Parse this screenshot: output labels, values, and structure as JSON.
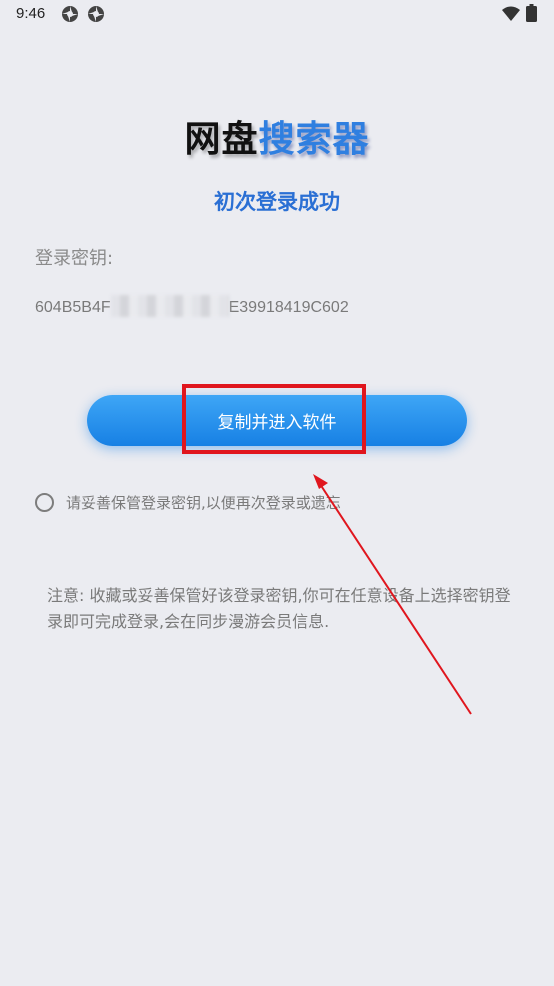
{
  "status_bar": {
    "time": "9:46",
    "icons": [
      "notification-icon",
      "notification-icon",
      "wifi-icon",
      "battery-icon"
    ]
  },
  "title": {
    "part1": "网盘",
    "part2": "搜索器"
  },
  "subtitle": "初次登录成功",
  "key_label": "登录密钥:",
  "key_value": {
    "prefix": "604B5B4F",
    "suffix": "E39918419C602"
  },
  "enter_button": "复制并进入软件",
  "agree_text": "请妥善保管登录密钥,以便再次登录或遗忘",
  "note": "注意: 收藏或妥善保管好该登录密钥,你可在任意设备上选择密钥登录即可完成登录,会在同步漫游会员信息.",
  "colors": {
    "background": "#ebecf1",
    "accent": "#2f7fe0",
    "highlight": "#e0161e"
  }
}
